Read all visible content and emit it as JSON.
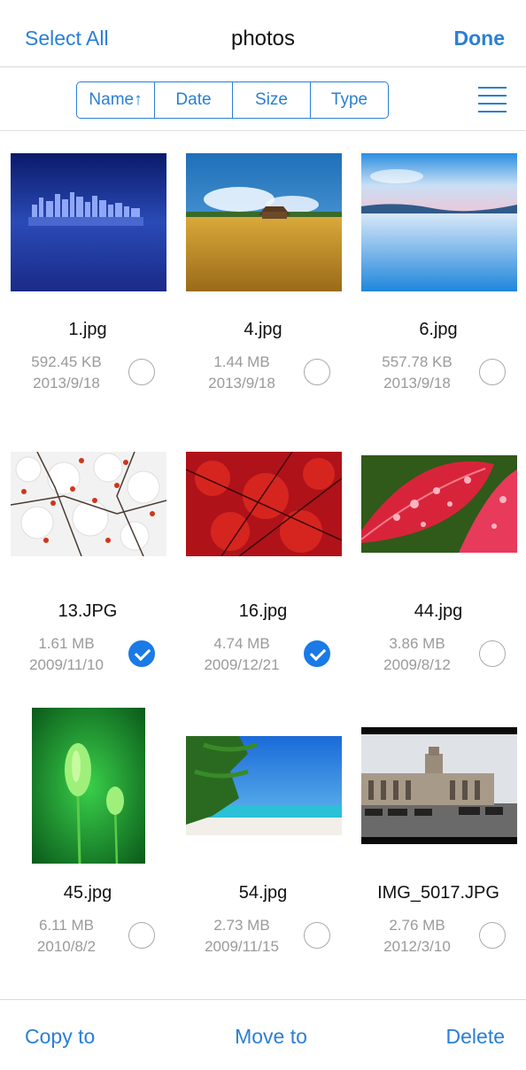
{
  "navbar": {
    "left_label": "Select All",
    "title": "photos",
    "right_label": "Done"
  },
  "sort": {
    "options": [
      "Name↑",
      "Date",
      "Size",
      "Type"
    ],
    "menu_icon": "list-icon"
  },
  "files": [
    {
      "name": "1.jpg",
      "size": "592.45 KB",
      "date": "2013/9/18",
      "selected": false
    },
    {
      "name": "4.jpg",
      "size": "1.44 MB",
      "date": "2013/9/18",
      "selected": false
    },
    {
      "name": "6.jpg",
      "size": "557.78 KB",
      "date": "2013/9/18",
      "selected": false
    },
    {
      "name": "13.JPG",
      "size": "1.61 MB",
      "date": "2009/11/10",
      "selected": true
    },
    {
      "name": "16.jpg",
      "size": "4.74 MB",
      "date": "2009/12/21",
      "selected": true
    },
    {
      "name": "44.jpg",
      "size": "3.86 MB",
      "date": "2009/8/12",
      "selected": false
    },
    {
      "name": "45.jpg",
      "size": "6.11 MB",
      "date": "2010/8/2",
      "selected": false
    },
    {
      "name": "54.jpg",
      "size": "2.73 MB",
      "date": "2009/11/15",
      "selected": false
    },
    {
      "name": "IMG_5017.JPG",
      "size": "2.76 MB",
      "date": "2012/3/10",
      "selected": false
    }
  ],
  "bottombar": {
    "copy_label": "Copy to",
    "move_label": "Move to",
    "delete_label": "Delete"
  },
  "colors": {
    "accent": "#2a7fd6",
    "check_selected": "#1a7ae6",
    "meta_text": "#9a9a9a"
  }
}
